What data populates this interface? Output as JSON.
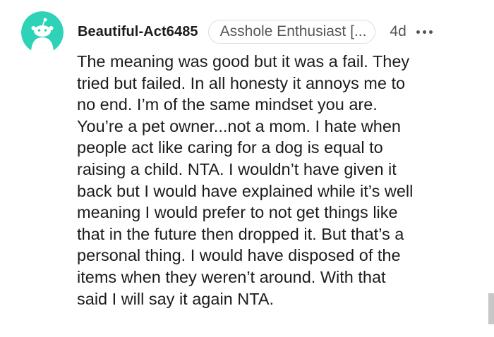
{
  "comment": {
    "author": "Beautiful-Act6485",
    "flair": "Asshole Enthusiast [...",
    "time_ago": "4d",
    "body": "The meaning was good but it was a fail. They\ntried but failed. In all honesty it annoys me to\nno end. I’m of the same mindset you are.\nYou’re a pet owner...not a mom. I hate when\npeople act like caring for a dog is equal to\nraising a child. NTA. I wouldn’t have given it\nback but I would have explained while it’s well\nmeaning I would prefer to not get things like\nthat in the future then dropped it. But that’s a\npersonal thing. I would have disposed of the\nitems when they weren’t around. With that\nsaid I will say it again NTA."
  },
  "colors": {
    "avatar_bg": "#2ed3b7",
    "avatar_figure": "#ffffff",
    "text": "#1c1c1c",
    "meta": "#555555"
  },
  "icons": {
    "avatar": "snoo-avatar-icon",
    "more": "more-options-icon"
  }
}
